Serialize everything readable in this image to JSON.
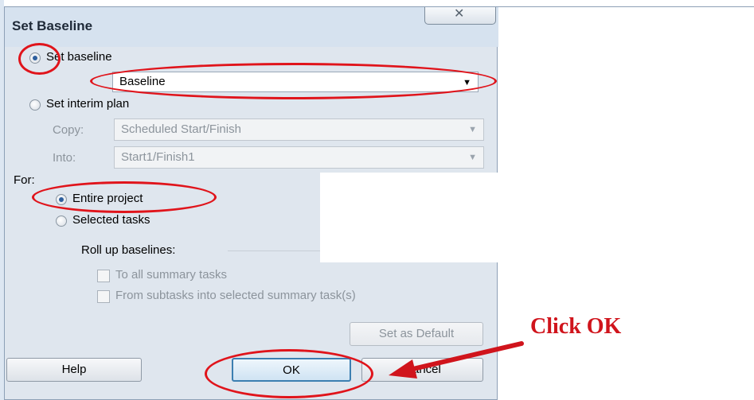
{
  "dialog": {
    "title": "Set Baseline",
    "close_glyph": "✕"
  },
  "baseline": {
    "set_baseline_label": "Set baseline",
    "selected_baseline": "Baseline",
    "set_interim_label": "Set interim plan",
    "copy_label": "Copy:",
    "copy_value": "Scheduled Start/Finish",
    "into_label": "Into:",
    "into_value": "Start1/Finish1"
  },
  "scope": {
    "for_label": "For:",
    "entire_project_label": "Entire project",
    "selected_tasks_label": "Selected tasks",
    "rollup_label": "Roll up baselines:",
    "to_all_summary_label": "To all summary tasks",
    "from_subtasks_label": "From subtasks into selected summary task(s)"
  },
  "buttons": {
    "set_default": "Set as Default",
    "help": "Help",
    "ok": "OK",
    "cancel": "Cancel"
  },
  "annotation": {
    "callout_text": "Click OK",
    "color": "#e0141b"
  }
}
